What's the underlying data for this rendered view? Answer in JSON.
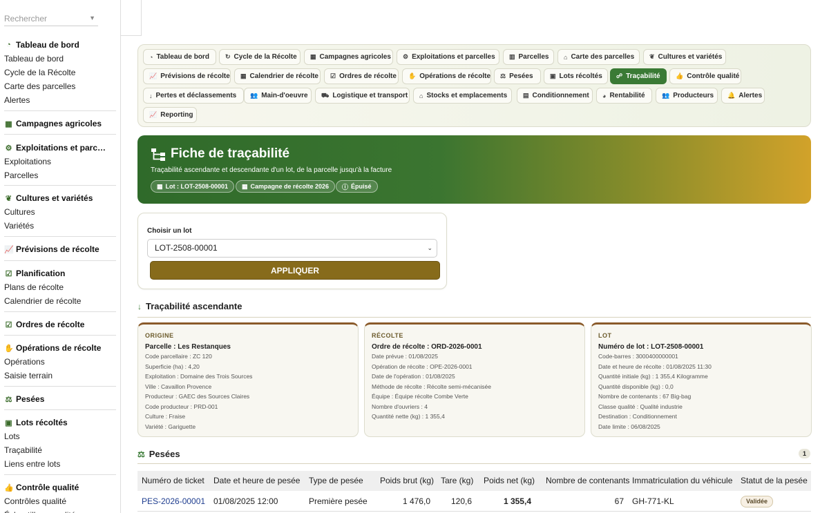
{
  "search": {
    "placeholder": "Rechercher"
  },
  "sidebar": {
    "groups": [
      {
        "title": "Tableau de bord",
        "icon": "gauge-icon",
        "items": [
          "Tableau de bord",
          "Cycle de la Récolte",
          "Carte des parcelles",
          "Alertes"
        ]
      },
      {
        "title": "Campagnes agricoles",
        "icon": "calendar-icon",
        "items": []
      },
      {
        "title": "Exploitations et parc…",
        "icon": "tractor-icon",
        "items": [
          "Exploitations",
          "Parcelles"
        ]
      },
      {
        "title": "Cultures et variétés",
        "icon": "seedling-icon",
        "items": [
          "Cultures",
          "Variétés"
        ]
      },
      {
        "title": "Prévisions de récolte",
        "icon": "chart-line-icon",
        "items": []
      },
      {
        "title": "Planification",
        "icon": "clipboard-check-icon",
        "items": [
          "Plans de récolte",
          "Calendrier de récolte"
        ]
      },
      {
        "title": "Ordres de récolte",
        "icon": "clipboard-check-icon",
        "items": []
      },
      {
        "title": "Opérations de récolte",
        "icon": "hand-icon",
        "items": [
          "Opérations",
          "Saisie terrain"
        ]
      },
      {
        "title": "Pesées",
        "icon": "scale-icon",
        "items": []
      },
      {
        "title": "Lots récoltés",
        "icon": "box-icon",
        "items": [
          "Lots",
          "Traçabilité",
          "Liens entre lots"
        ]
      },
      {
        "title": "Contrôle qualité",
        "icon": "thumb-up-icon",
        "items": [
          "Contrôles qualité",
          "Échantillons qualité"
        ]
      }
    ]
  },
  "modules": [
    {
      "label": "Tableau de bord",
      "icon": "gauge-icon"
    },
    {
      "label": "Cycle de la Récolte",
      "icon": "refresh-icon"
    },
    {
      "label": "Campagnes agricoles",
      "icon": "calendar-icon"
    },
    {
      "label": "Exploitations et parcelles",
      "icon": "tractor-icon"
    },
    {
      "label": "Parcelles",
      "icon": "map-icon"
    },
    {
      "label": "Carte des parcelles",
      "icon": "map-pin-icon"
    },
    {
      "label": "Cultures et variétés",
      "icon": "seedling-icon"
    },
    {
      "label": "Prévisions de récolte",
      "icon": "chart-line-icon"
    },
    {
      "label": "Calendrier de récolte",
      "icon": "calendar-icon"
    },
    {
      "label": "Ordres de récolte",
      "icon": "clipboard-check-icon"
    },
    {
      "label": "Opérations de récolte",
      "icon": "hand-icon"
    },
    {
      "label": "Pesées",
      "icon": "scale-icon"
    },
    {
      "label": "Lots récoltés",
      "icon": "box-icon"
    },
    {
      "label": "Traçabilité",
      "icon": "sitemap-icon",
      "active": true
    },
    {
      "label": "Contrôle qualité",
      "icon": "thumb-up-icon"
    },
    {
      "label": "Pertes et déclassements",
      "icon": "arrow-down-icon"
    },
    {
      "label": "Main-d'oeuvre",
      "icon": "users-icon"
    },
    {
      "label": "Logistique et transport",
      "icon": "truck-icon"
    },
    {
      "label": "Stocks et emplacements",
      "icon": "warehouse-icon"
    },
    {
      "label": "Conditionnement",
      "icon": "boxes-icon"
    },
    {
      "label": "Rentabilité",
      "icon": "pie-chart-icon"
    },
    {
      "label": "Producteurs",
      "icon": "users-icon"
    },
    {
      "label": "Alertes",
      "icon": "bell-icon"
    },
    {
      "label": "Reporting",
      "icon": "chart-line-icon"
    }
  ],
  "hero": {
    "title": "Fiche de traçabilité",
    "subtitle": "Traçabilité ascendante et descendante d'un lot, de la parcelle jusqu'à la facture",
    "chips": [
      "Lot : LOT-2508-00001",
      "Campagne de récolte 2026",
      "Épuisé"
    ]
  },
  "chooser": {
    "label": "Choisir un lot",
    "selected": "LOT-2508-00001",
    "apply_label": "APPLIQUER"
  },
  "ascendante": {
    "title": "Traçabilité ascendante",
    "cards": [
      {
        "caption": "ORIGINE",
        "title": "Parcelle : Les Restanques",
        "rows": [
          "Code parcellaire : ZC 120",
          "Superficie (ha) : 4,20",
          "Exploitation : Domaine des Trois Sources",
          "Ville : Cavaillon Provence",
          "Producteur : GAEC des Sources Claires",
          "Code producteur : PRD-001",
          "Culture : Fraise",
          "Variété : Gariguette"
        ]
      },
      {
        "caption": "RÉCOLTE",
        "title": "Ordre de récolte : ORD-2026-0001",
        "rows": [
          "Date prévue : 01/08/2025",
          "Opération de récolte : OPE-2026-0001",
          "Date de l'opération : 01/08/2025",
          "Méthode de récolte : Récolte semi-mécanisée",
          "Équipe : Équipe récolte Combe Verte",
          "Nombre d'ouvriers : 4",
          "Quantité nette (kg) : 1 355,4"
        ]
      },
      {
        "caption": "LOT",
        "title": "Numéro de lot : LOT-2508-00001",
        "rows": [
          "Code-barres : 3000400000001",
          "Date et heure de récolte : 01/08/2025 11:30",
          "Quantité initiale (kg) : 1 355,4 Kilogramme",
          "Quantité disponible (kg) : 0,0",
          "Nombre de contenants : 67 Big-bag",
          "Classe qualité : Qualité industrie",
          "Destination : Conditionnement",
          "Date limite : 06/08/2025"
        ]
      }
    ]
  },
  "pesees": {
    "title": "Pesées",
    "count": "1",
    "columns": [
      "Numéro de ticket",
      "Date et heure de pesée",
      "Type de pesée",
      "Poids brut (kg)",
      "Tare (kg)",
      "Poids net (kg)",
      "Nombre de contenants",
      "Immatriculation du véhicule",
      "Statut de la pesée"
    ],
    "rows": [
      [
        "PES-2026-00001",
        "01/08/2025 12:00",
        "Première pesée",
        "1 476,0",
        "120,6",
        "1 355,4",
        "67",
        "GH-771-KL",
        "Validée"
      ]
    ]
  }
}
